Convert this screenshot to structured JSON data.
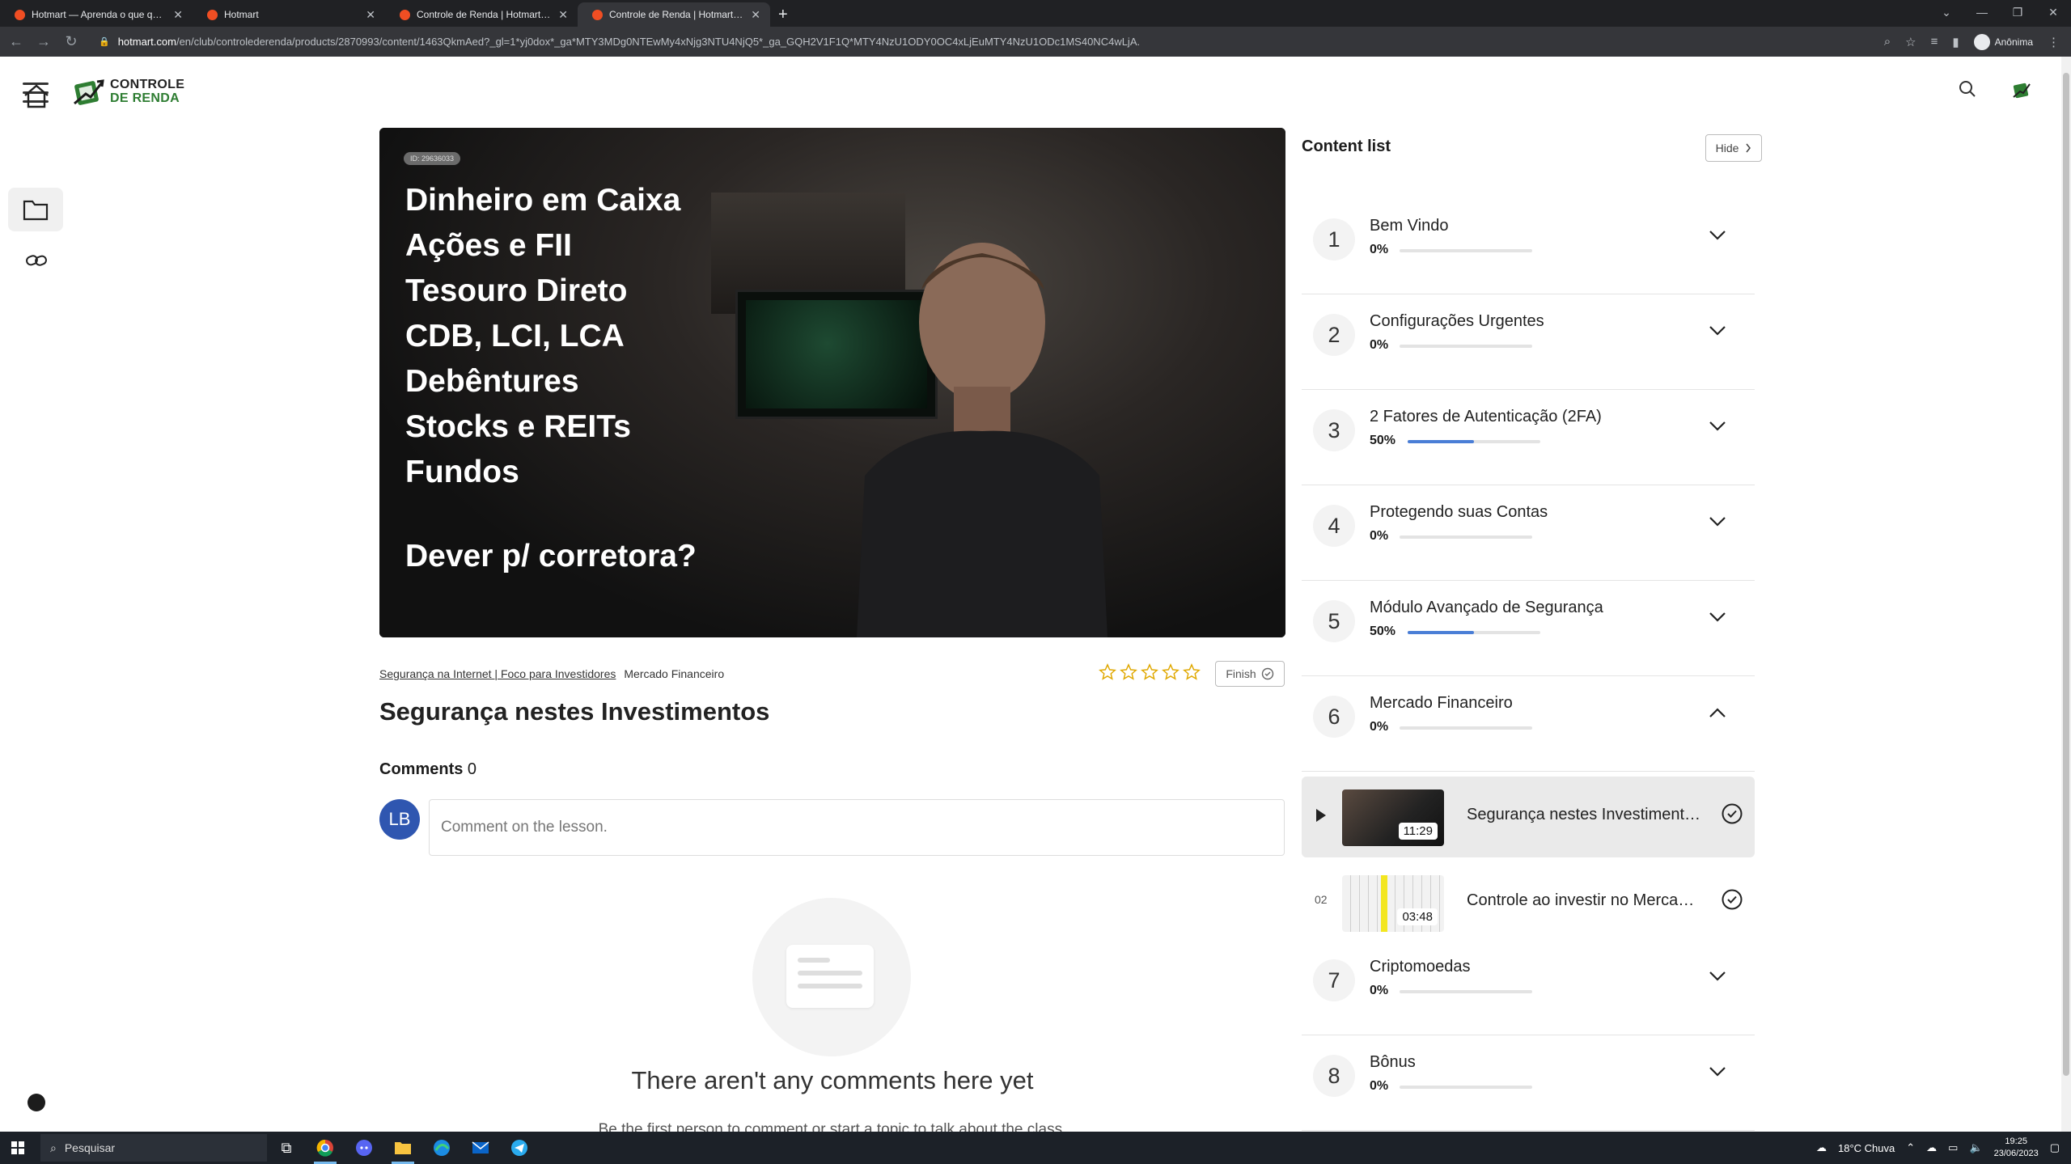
{
  "browser": {
    "tabs": [
      {
        "title": "Hotmart — Aprenda o que quise",
        "active": false
      },
      {
        "title": "Hotmart",
        "active": false
      },
      {
        "title": "Controle de Renda | Hotmart Clu",
        "active": false
      },
      {
        "title": "Controle de Renda | Hotmart Clu",
        "active": true
      }
    ],
    "url_host": "hotmart.com",
    "url_path": "/en/club/controlederenda/products/2870993/content/1463QkmAed?_gl=1*yj0dox*_ga*MTY3MDg0NTEwMy4xNjg3NTU4NjQ5*_ga_GQH2V1F1Q*MTY4NzU1ODY0OC4xLjEuMTY4NzU1ODc1MS40NC4wLjA.",
    "profile": "Anônima"
  },
  "header": {
    "logo_line1": "CONTROLE",
    "logo_line2": "DE RENDA"
  },
  "video": {
    "id_badge": "ID: 29636033",
    "lines": [
      "Dinheiro em Caixa",
      "Ações e FII",
      "Tesouro Direto",
      "CDB, LCI, LCA",
      "Debêntures",
      "Stocks e REITs",
      "Fundos"
    ],
    "question": "Dever p/ corretora?"
  },
  "lesson": {
    "breadcrumb_course": "Segurança na Internet | Foco para Investidores",
    "breadcrumb_module": "Mercado Financeiro",
    "finish_label": "Finish",
    "title": "Segurança nestes Investimentos",
    "rating": 0,
    "rating_max": 5
  },
  "comments": {
    "label": "Comments",
    "count": "0",
    "avatar_initials": "LB",
    "placeholder": "Comment on the lesson.",
    "empty_title": "There aren't any comments here yet",
    "empty_sub": "Be the first person to comment or start a topic to talk about the class."
  },
  "content_list": {
    "title": "Content list",
    "hide_label": "Hide",
    "modules": [
      {
        "num": "1",
        "title": "Bem Vindo",
        "pct_label": "0%",
        "progress": 0,
        "expanded": false
      },
      {
        "num": "2",
        "title": "Configurações Urgentes",
        "pct_label": "0%",
        "progress": 0,
        "expanded": false
      },
      {
        "num": "3",
        "title": "2 Fatores de Autenticação (2FA)",
        "pct_label": "50%",
        "progress": 0.5,
        "expanded": false
      },
      {
        "num": "4",
        "title": "Protegendo suas Contas",
        "pct_label": "0%",
        "progress": 0,
        "expanded": false
      },
      {
        "num": "5",
        "title": "Módulo Avançado de Segurança",
        "pct_label": "50%",
        "progress": 0.5,
        "expanded": false
      },
      {
        "num": "6",
        "title": "Mercado Financeiro",
        "pct_label": "0%",
        "progress": 0,
        "expanded": true
      },
      {
        "num": "7",
        "title": "Criptomoedas",
        "pct_label": "0%",
        "progress": 0,
        "expanded": false
      },
      {
        "num": "8",
        "title": "Bônus",
        "pct_label": "0%",
        "progress": 0,
        "expanded": false
      }
    ],
    "lessons": [
      {
        "index": "",
        "duration": "11:29",
        "title": "Segurança nestes Investimentos",
        "current": true
      },
      {
        "index": "02",
        "duration": "03:48",
        "title": "Controle ao investir no Mercado Financeiro",
        "current": false
      }
    ]
  },
  "taskbar": {
    "search_placeholder": "Pesquisar",
    "weather": "18°C  Chuva",
    "time": "19:25",
    "date": "23/06/2023"
  },
  "colors": {
    "progress_fill": "#4a7ed6",
    "avatar_bg": "#2f56b0",
    "brand_green": "#2e7d32",
    "star": "#e0a800"
  }
}
